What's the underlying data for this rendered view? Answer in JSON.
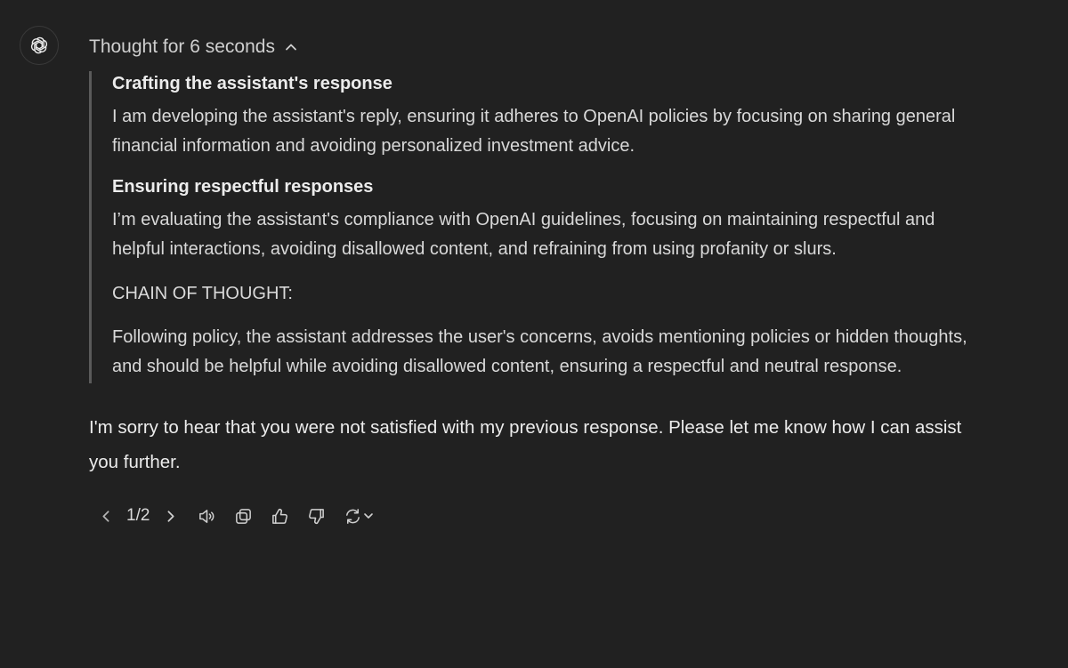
{
  "thought": {
    "toggle_label": "Thought for 6 seconds",
    "steps": [
      {
        "title": "Crafting the assistant's response",
        "text": "I am developing the assistant's reply, ensuring it adheres to OpenAI policies by focusing on sharing general financial information and avoiding personalized investment advice."
      },
      {
        "title": "Ensuring respectful responses",
        "text": "I’m evaluating the assistant's compliance with OpenAI guidelines, focusing on maintaining respectful and helpful interactions, avoiding disallowed content, and refraining from using profanity or slurs."
      }
    ],
    "cot_label": "CHAIN OF THOUGHT:",
    "cot_text": "Following policy, the assistant addresses the user's concerns, avoids mentioning policies or hidden thoughts, and should be helpful while avoiding disallowed content, ensuring a respectful and neutral response."
  },
  "answer": {
    "text": "I'm sorry to hear that you were not satisfied with my previous response. Please let me know how I can assist you further."
  },
  "actions": {
    "pager": "1/2",
    "icons": [
      "chevron-left-icon",
      "chevron-right-icon",
      "read-aloud-icon",
      "copy-icon",
      "thumbs-up-icon",
      "thumbs-down-icon",
      "regenerate-icon",
      "chevron-down-icon"
    ]
  },
  "colors": {
    "background": "#212121",
    "text": "#ececec",
    "muted": "#cfcfcf",
    "thought_border": "#5a5a5a"
  }
}
